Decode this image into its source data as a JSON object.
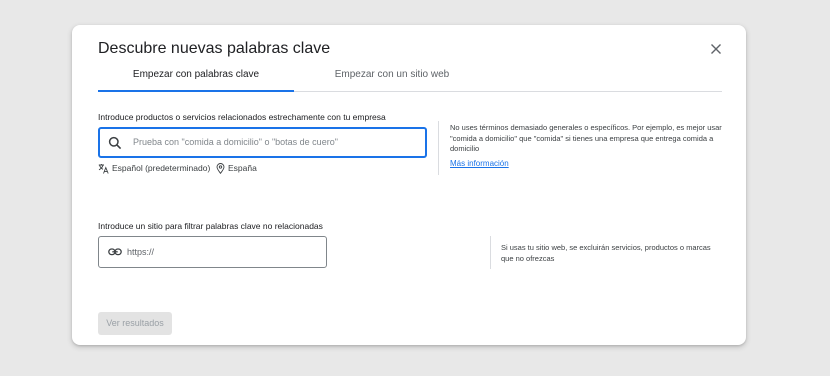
{
  "dialog": {
    "title": "Descubre nuevas palabras clave",
    "close_icon": "close-icon"
  },
  "tabs": [
    {
      "label": "Empezar con palabras clave",
      "selected": true
    },
    {
      "label": "Empezar con un sitio web",
      "selected": false
    }
  ],
  "keywords_section": {
    "label": "Introduce productos o servicios relacionados estrechamente con tu empresa",
    "placeholder": "Prueba con \"comida a domicilio\" o \"botas de cuero\"",
    "search_icon": "search-icon",
    "language_icon": "translate-icon",
    "language": "Español (predeterminado)",
    "location_icon": "location-pin-icon",
    "location": "España",
    "help_text": "No uses términos demasiado generales o específicos. Por ejemplo, es mejor usar \"comida a domicilio\" que \"comida\" si tienes una empresa que entrega comida a domicilio",
    "help_link": "Más información"
  },
  "site_section": {
    "label": "Introduce un sitio para filtrar palabras clave no relacionadas",
    "placeholder": "https://",
    "link_icon": "link-icon",
    "help_text": "Si usas tu sitio web, se excluirán servicios, productos o marcas que no ofrezcas"
  },
  "actions": {
    "submit_label": "Ver resultados",
    "submit_enabled": false
  },
  "colors": {
    "accent": "#1a73e8",
    "disabled_button_bg": "#e3e3e3",
    "disabled_button_text": "#9aa0a6"
  }
}
